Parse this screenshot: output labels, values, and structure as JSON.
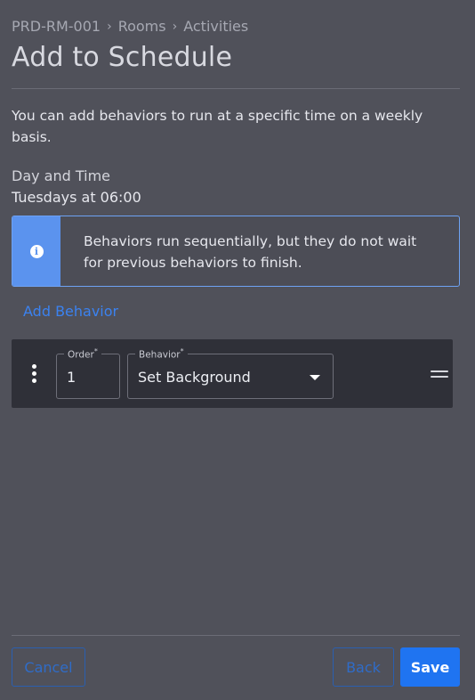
{
  "breadcrumb": {
    "items": [
      "PRD-RM-001",
      "Rooms",
      "Activities"
    ],
    "separator": "›"
  },
  "page": {
    "title": "Add to Schedule",
    "description": "You can add behaviors to run at a specific time on a weekly basis."
  },
  "schedule": {
    "day_time_label": "Day and Time",
    "day_time_value": "Tuesdays at 06:00"
  },
  "info": {
    "icon": "info-icon",
    "icon_glyph": "i",
    "text": "Behaviors run sequentially, but they do not wait for previous behaviors to finish."
  },
  "add_behavior_label": "Add Behavior",
  "behaviors": [
    {
      "order_label": "Order",
      "order_value": "1",
      "behavior_label": "Behavior",
      "behavior_value": "Set Background",
      "required_marker": "*"
    }
  ],
  "footer": {
    "cancel_label": "Cancel",
    "back_label": "Back",
    "save_label": "Save"
  },
  "colors": {
    "background": "#50515a",
    "accent": "#1f74f1",
    "info_strip": "#5b93ee",
    "row_background": "#2f3038"
  }
}
